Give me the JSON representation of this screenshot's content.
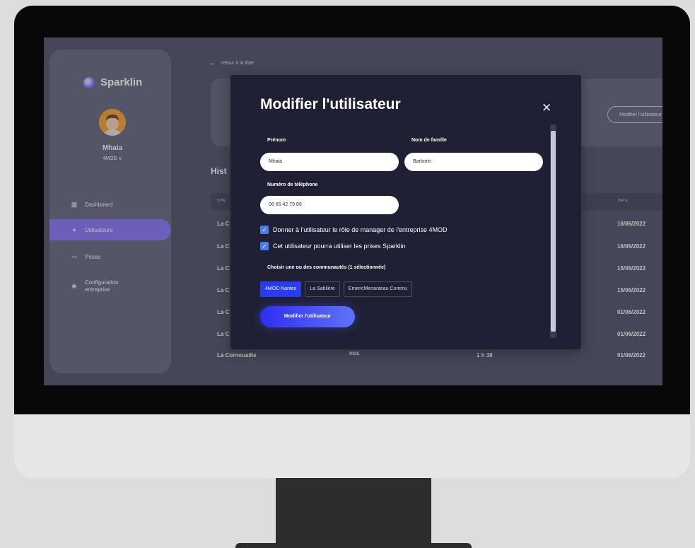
{
  "colors": {
    "accent": "#8c7cf7",
    "primary_button": "#2f2ef2",
    "checkbox": "#4a7cf0",
    "modal_bg": "#1f2033"
  },
  "sidebar": {
    "brand": "Sparklin",
    "user_name": "Mhaia",
    "company": "4MOD ∨",
    "items": [
      {
        "label": "Dashboard",
        "icon": "dashboard-icon"
      },
      {
        "label": "Utilisateurs",
        "icon": "user-icon",
        "active": true
      },
      {
        "label": "Prises",
        "icon": "plug-icon"
      },
      {
        "label": "Configuration\nentreprise",
        "icon": "gear-icon"
      }
    ]
  },
  "main": {
    "back_label": "retour à la liste",
    "modify_user_button": "Modifier l'utilisateur",
    "history_title": "Hist",
    "table": {
      "headers": {
        "site": "SITE",
        "date": "DATE"
      },
      "rows": [
        {
          "site": "La C",
          "type": "",
          "duration": "",
          "date": "16/06/2022"
        },
        {
          "site": "La C",
          "type": "",
          "duration": "",
          "date": "16/06/2022"
        },
        {
          "site": "La C",
          "type": "",
          "duration": "",
          "date": "15/06/2022"
        },
        {
          "site": "La C",
          "type": "",
          "duration": "",
          "date": "15/06/2022"
        },
        {
          "site": "La C",
          "type": "",
          "duration": "",
          "date": "01/06/2022"
        },
        {
          "site": "La C",
          "type": "",
          "duration": "",
          "date": "01/06/2022"
        },
        {
          "site": "La Cornouaille",
          "type": "RIDE",
          "duration": "1 h 38",
          "date": "01/06/2022"
        }
      ]
    }
  },
  "modal": {
    "title": "Modifier l'utilisateur",
    "close": "✕",
    "first_name": {
      "label": "Prénom",
      "value": "Mhaia"
    },
    "last_name": {
      "label": "Nom de famille",
      "value": "Barbotin"
    },
    "phone": {
      "label": "Numéro de téléphone",
      "value": "06 65 42 79 89"
    },
    "checkbox_manager": {
      "label": "Donner à l'utilisateur le rôle de manager de l'entreprise 4MOD",
      "checked": true
    },
    "checkbox_prises": {
      "label": "Cet utilisateur pourra utiliser les prises Sparklin",
      "checked": true
    },
    "communities_label": "Choisir une ou des communautés (1 sélectionnée)",
    "communities": [
      {
        "label": "4MOD Nantes",
        "selected": true
      },
      {
        "label": "La Sablière",
        "selected": false
      },
      {
        "label": "EmericMenanteau Commu",
        "selected": false
      }
    ],
    "submit": "Modifier l'utilisateur"
  }
}
